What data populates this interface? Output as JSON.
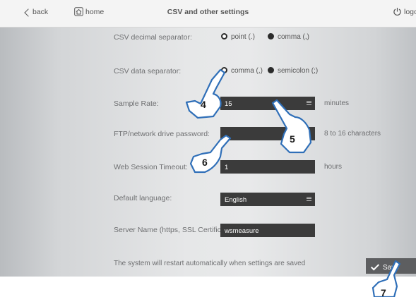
{
  "header": {
    "back_label": "back",
    "home_label": "home",
    "title": "CSV and other settings",
    "logout_label": "logo"
  },
  "settings": {
    "csv_decimal": {
      "label": "CSV decimal separator:",
      "options": [
        {
          "label": "point (.)",
          "selected": true
        },
        {
          "label": "comma (,)",
          "selected": false
        }
      ]
    },
    "csv_data": {
      "label": "CSV data separator:",
      "options": [
        {
          "label": "comma (,)",
          "selected": true
        },
        {
          "label": "semicolon (;)",
          "selected": false
        }
      ]
    },
    "sample_rate": {
      "label": "Sample Rate:",
      "value": "15",
      "unit": "minutes"
    },
    "ftp_password": {
      "label": "FTP/network drive password:",
      "value": "",
      "hint": "8 to 16 characters"
    },
    "web_timeout": {
      "label": "Web Session Timeout:",
      "value": "1",
      "unit": "hours"
    },
    "language": {
      "label": "Default language:",
      "value": "English"
    },
    "server_name": {
      "label": "Server Name (https, SSL Certificate)",
      "value": "wsmeasure"
    }
  },
  "footer": {
    "note": "The system will restart automatically when settings are saved",
    "save_label": "Save"
  },
  "annotations": {
    "step4": "4",
    "step5": "5",
    "step6": "6",
    "step7": "7"
  },
  "colors": {
    "field_bg": "#3b3b3b",
    "save_bg": "#5d5e60",
    "hand_outline": "#2f6fb8"
  }
}
